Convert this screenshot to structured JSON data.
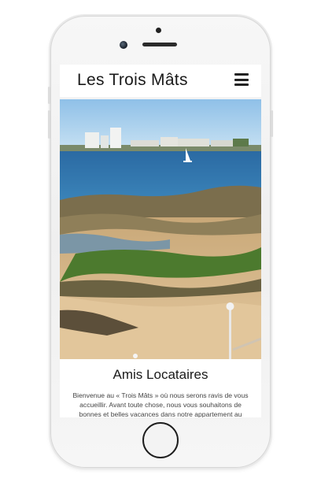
{
  "site": {
    "title": "Les Trois Mâts",
    "menu_icon": "hamburger-menu-icon"
  },
  "hero": {
    "description": "Photo of a beach at low tide with rocks and seaweed, the sea and a town on the far shore"
  },
  "content": {
    "heading": "Amis Locataires",
    "welcome_text": "Bienvenue au « Trois Mâts » où nous serons ravis de vous accueillir. Avant toute chose, nous vous souhaitons de bonnes et belles vacances dans notre appartement au"
  },
  "colors": {
    "sky": "#9ec9ea",
    "sea": "#2f6fa6",
    "sand": "#d9bd8f",
    "seaweed": "#4c7a2e",
    "text": "#1a1a1a"
  }
}
